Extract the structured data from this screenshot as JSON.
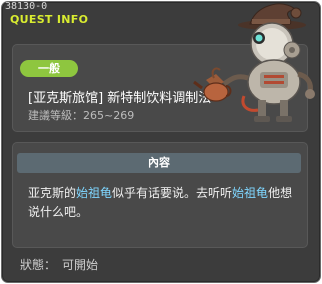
{
  "window": {
    "quest_id": "38130-0",
    "section_label": "QUEST INFO"
  },
  "quest": {
    "badge": "一般",
    "title": "[亚克斯旅馆] 新特制饮料调制法",
    "required_level": "建議等級：265~269"
  },
  "content": {
    "header": "內容",
    "text_1": "亚克斯的",
    "npc_1": "始祖龟",
    "text_2": "似乎有话要说。去听听",
    "npc_2": "始祖龟",
    "text_3": "他想说什么吧。",
    "npc_color": "#7fd6ff"
  },
  "status": {
    "label": "狀態：",
    "value": "可開始"
  },
  "colors": {
    "badge": "#8ec63f",
    "section_label": "#d9ec30",
    "content_header": "#5c6a72"
  },
  "icons": {
    "npc": "steam-robot-with-witch-hat-portrait",
    "kettle": "kettle-icon"
  }
}
